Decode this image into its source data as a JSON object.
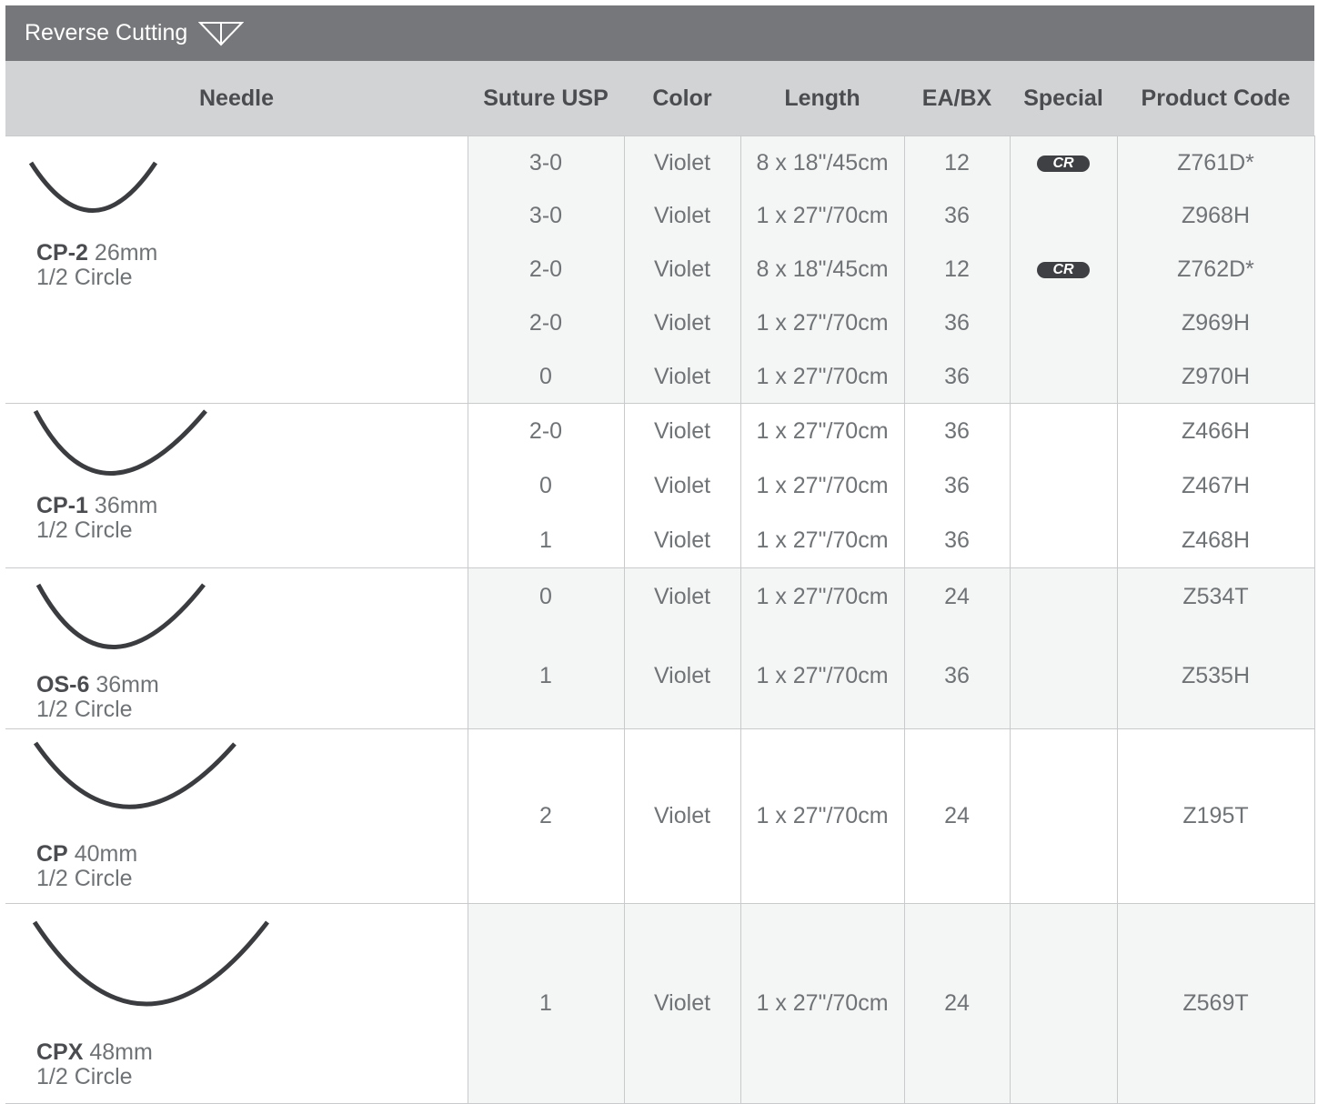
{
  "section": {
    "title": "Reverse Cutting"
  },
  "headers": {
    "needle": "Needle",
    "suture_usp": "Suture USP",
    "color": "Color",
    "length": "Length",
    "ea_bx": "EA/BX",
    "special": "Special",
    "product_code": "Product Code"
  },
  "groups": [
    {
      "needle_name": "CP-2",
      "needle_size": "26mm",
      "needle_shape": "1/2 Circle",
      "rows": [
        {
          "usp": "3-0",
          "color": "Violet",
          "length": "8 x 18\"/45cm",
          "ea": "12",
          "special": "CR",
          "code": "Z761D*"
        },
        {
          "usp": "3-0",
          "color": "Violet",
          "length": "1 x 27\"/70cm",
          "ea": "36",
          "special": "",
          "code": "Z968H"
        },
        {
          "usp": "2-0",
          "color": "Violet",
          "length": "8 x 18\"/45cm",
          "ea": "12",
          "special": "CR",
          "code": "Z762D*"
        },
        {
          "usp": "2-0",
          "color": "Violet",
          "length": "1 x 27\"/70cm",
          "ea": "36",
          "special": "",
          "code": "Z969H"
        },
        {
          "usp": "0",
          "color": "Violet",
          "length": "1 x 27\"/70cm",
          "ea": "36",
          "special": "",
          "code": "Z970H"
        }
      ]
    },
    {
      "needle_name": "CP-1",
      "needle_size": "36mm",
      "needle_shape": "1/2 Circle",
      "rows": [
        {
          "usp": "2-0",
          "color": "Violet",
          "length": "1 x 27\"/70cm",
          "ea": "36",
          "special": "",
          "code": "Z466H"
        },
        {
          "usp": "0",
          "color": "Violet",
          "length": "1 x 27\"/70cm",
          "ea": "36",
          "special": "",
          "code": "Z467H"
        },
        {
          "usp": "1",
          "color": "Violet",
          "length": "1 x 27\"/70cm",
          "ea": "36",
          "special": "",
          "code": "Z468H"
        }
      ]
    },
    {
      "needle_name": "OS-6",
      "needle_size": "36mm",
      "needle_shape": "1/2 Circle",
      "rows": [
        {
          "usp": "0",
          "color": "Violet",
          "length": "1 x 27\"/70cm",
          "ea": "24",
          "special": "",
          "code": "Z534T"
        },
        {
          "usp": "1",
          "color": "Violet",
          "length": "1 x 27\"/70cm",
          "ea": "36",
          "special": "",
          "code": "Z535H"
        }
      ]
    },
    {
      "needle_name": "CP",
      "needle_size": "40mm",
      "needle_shape": "1/2 Circle",
      "rows": [
        {
          "usp": "2",
          "color": "Violet",
          "length": "1 x 27\"/70cm",
          "ea": "24",
          "special": "",
          "code": "Z195T"
        }
      ]
    },
    {
      "needle_name": "CPX",
      "needle_size": "48mm",
      "needle_shape": "1/2 Circle",
      "rows": [
        {
          "usp": "1",
          "color": "Violet",
          "length": "1 x 27\"/70cm",
          "ea": "24",
          "special": "",
          "code": "Z569T"
        }
      ]
    }
  ],
  "colors": {
    "title_bar": "#76777a",
    "header_bg": "#d1d3d4",
    "alt_row": "#f4f5f5",
    "badge": "#3e4043"
  }
}
